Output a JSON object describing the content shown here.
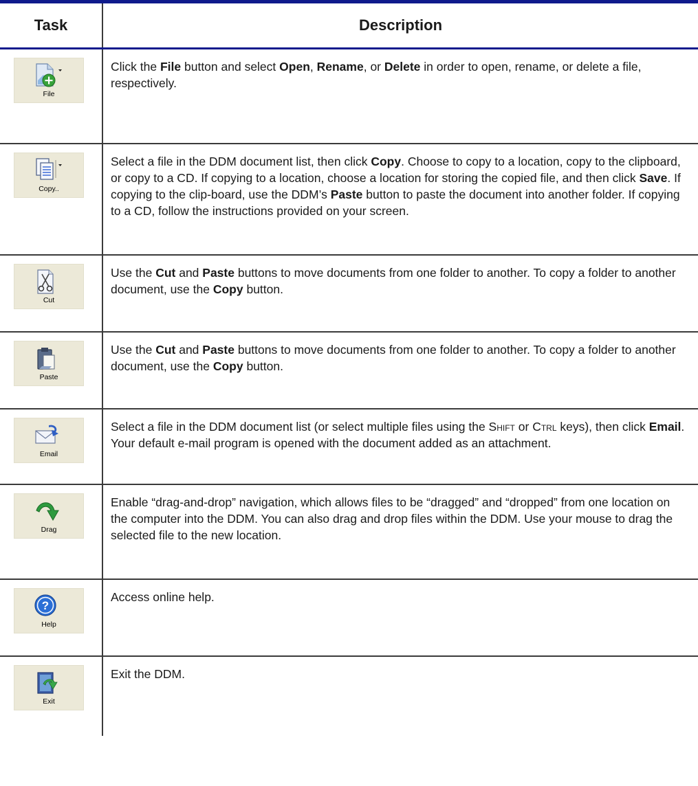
{
  "header": {
    "task": "Task",
    "description": "Description"
  },
  "rows": [
    {
      "button_label": "File",
      "icon": "file-add-icon",
      "desc": [
        "Click the ",
        {
          "b": "File"
        },
        " button and select ",
        {
          "b": "Open"
        },
        ", ",
        {
          "b": "Rename"
        },
        ", or ",
        {
          "b": "Delete"
        },
        " in order to open, rename, or delete a file, respectively."
      ]
    },
    {
      "button_label": "Copy..",
      "icon": "copy-icon",
      "desc": [
        "Select a file in the DDM document list, then click ",
        {
          "b": "Copy"
        },
        ". Choose to copy to a location, copy to the clipboard, or copy to a CD. If copying to a location, choose a location for storing the copied file, and then click ",
        {
          "b": "Save"
        },
        ". If copying to the clip-board, use the DDM’s ",
        {
          "b": "Paste"
        },
        " button to paste the document into another folder. If copying to a CD, follow the instructions provided on your screen."
      ]
    },
    {
      "button_label": "Cut",
      "icon": "scissors-icon",
      "desc": [
        "Use the ",
        {
          "b": "Cut"
        },
        " and ",
        {
          "b": "Paste"
        },
        " buttons to move documents from one folder to another. To copy a folder to another document, use the ",
        {
          "b": "Copy"
        },
        " button."
      ]
    },
    {
      "button_label": "Paste",
      "icon": "clipboard-icon",
      "desc": [
        "Use the ",
        {
          "b": "Cut"
        },
        " and ",
        {
          "b": "Paste"
        },
        " buttons to move documents from one folder to another. To copy a folder to another document, use the ",
        {
          "b": "Copy"
        },
        " button."
      ]
    },
    {
      "button_label": "Email",
      "icon": "envelope-icon",
      "desc": [
        "Select a file in the DDM document list (or select multiple files using the ",
        {
          "sc": "Shift"
        },
        " or ",
        {
          "sc": "Ctrl"
        },
        " keys), then click ",
        {
          "b": "Email"
        },
        ". Your default e-mail program is opened with the document added as an attachment."
      ]
    },
    {
      "button_label": "Drag",
      "icon": "curved-arrow-icon",
      "desc": [
        "Enable “drag-and-drop” navigation, which allows files to be “dragged” and “dropped” from one location on the computer into the DDM. You can also drag and drop files within the DDM. Use your mouse to drag the selected file to the new location."
      ]
    },
    {
      "button_label": "Help",
      "icon": "help-icon",
      "desc": [
        "Access online help."
      ]
    },
    {
      "button_label": "Exit",
      "icon": "exit-door-icon",
      "desc": [
        "Exit the DDM."
      ]
    }
  ]
}
